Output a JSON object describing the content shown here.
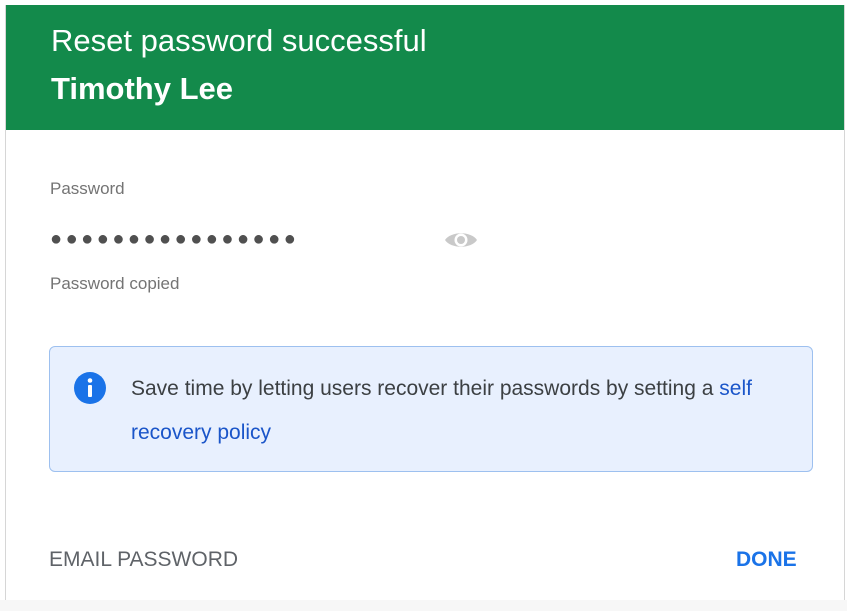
{
  "header": {
    "title": "Reset password successful",
    "user_name": "Timothy Lee",
    "background_color": "#138a4b"
  },
  "password_field": {
    "label": "Password",
    "masked_value": "●●●●●●●●●●●●●●●●",
    "reveal_icon": "eye-icon",
    "status": "Password copied"
  },
  "info_banner": {
    "icon": "info-icon",
    "text_before_link": "Save time by letting users recover their passwords by setting a ",
    "link_text": "self recovery policy",
    "accent_color": "#1a73e8"
  },
  "actions": {
    "email_password": "EMAIL PASSWORD",
    "done": "DONE"
  }
}
